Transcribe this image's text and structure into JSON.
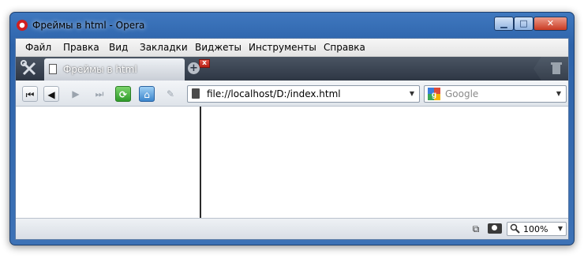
{
  "window": {
    "title": "Фреймы в html - Opera",
    "controls": {
      "minimize": "▁",
      "maximize": "□",
      "close": "✕"
    }
  },
  "menu": {
    "items": [
      "Файл",
      "Правка",
      "Вид",
      "Закладки",
      "Виджеты",
      "Инструменты",
      "Справка"
    ]
  },
  "tabs": {
    "active": {
      "title": "Фреймы в html",
      "close_glyph": "x"
    },
    "new_tab_glyph": "+"
  },
  "toolbar": {
    "rewind_glyph": "⏮",
    "back_glyph": "◀",
    "forward_glyph": "▶",
    "fast_forward_glyph": "⏭",
    "reload_glyph": "⟳",
    "home_glyph": "⌂",
    "wand_glyph": "✎",
    "address": "file://localhost/D:/index.html",
    "search_placeholder": "Google",
    "dropdown_glyph": "▼"
  },
  "statusbar": {
    "zoom": "100%",
    "zoom_icon_glyph": "🔍",
    "speed_dial_glyph": "⧉"
  },
  "colors": {
    "frame_blue": "#3f78bf",
    "tab_bar": "#2e3744",
    "close_red": "#c83a22",
    "reload_green": "#2f9b2a",
    "home_blue": "#3c86cc"
  },
  "icons": [
    "opera-logo-icon",
    "tools-icon",
    "page-icon",
    "trash-icon",
    "google-icon",
    "camera-icon",
    "speed-dial-icon",
    "zoom-icon"
  ]
}
